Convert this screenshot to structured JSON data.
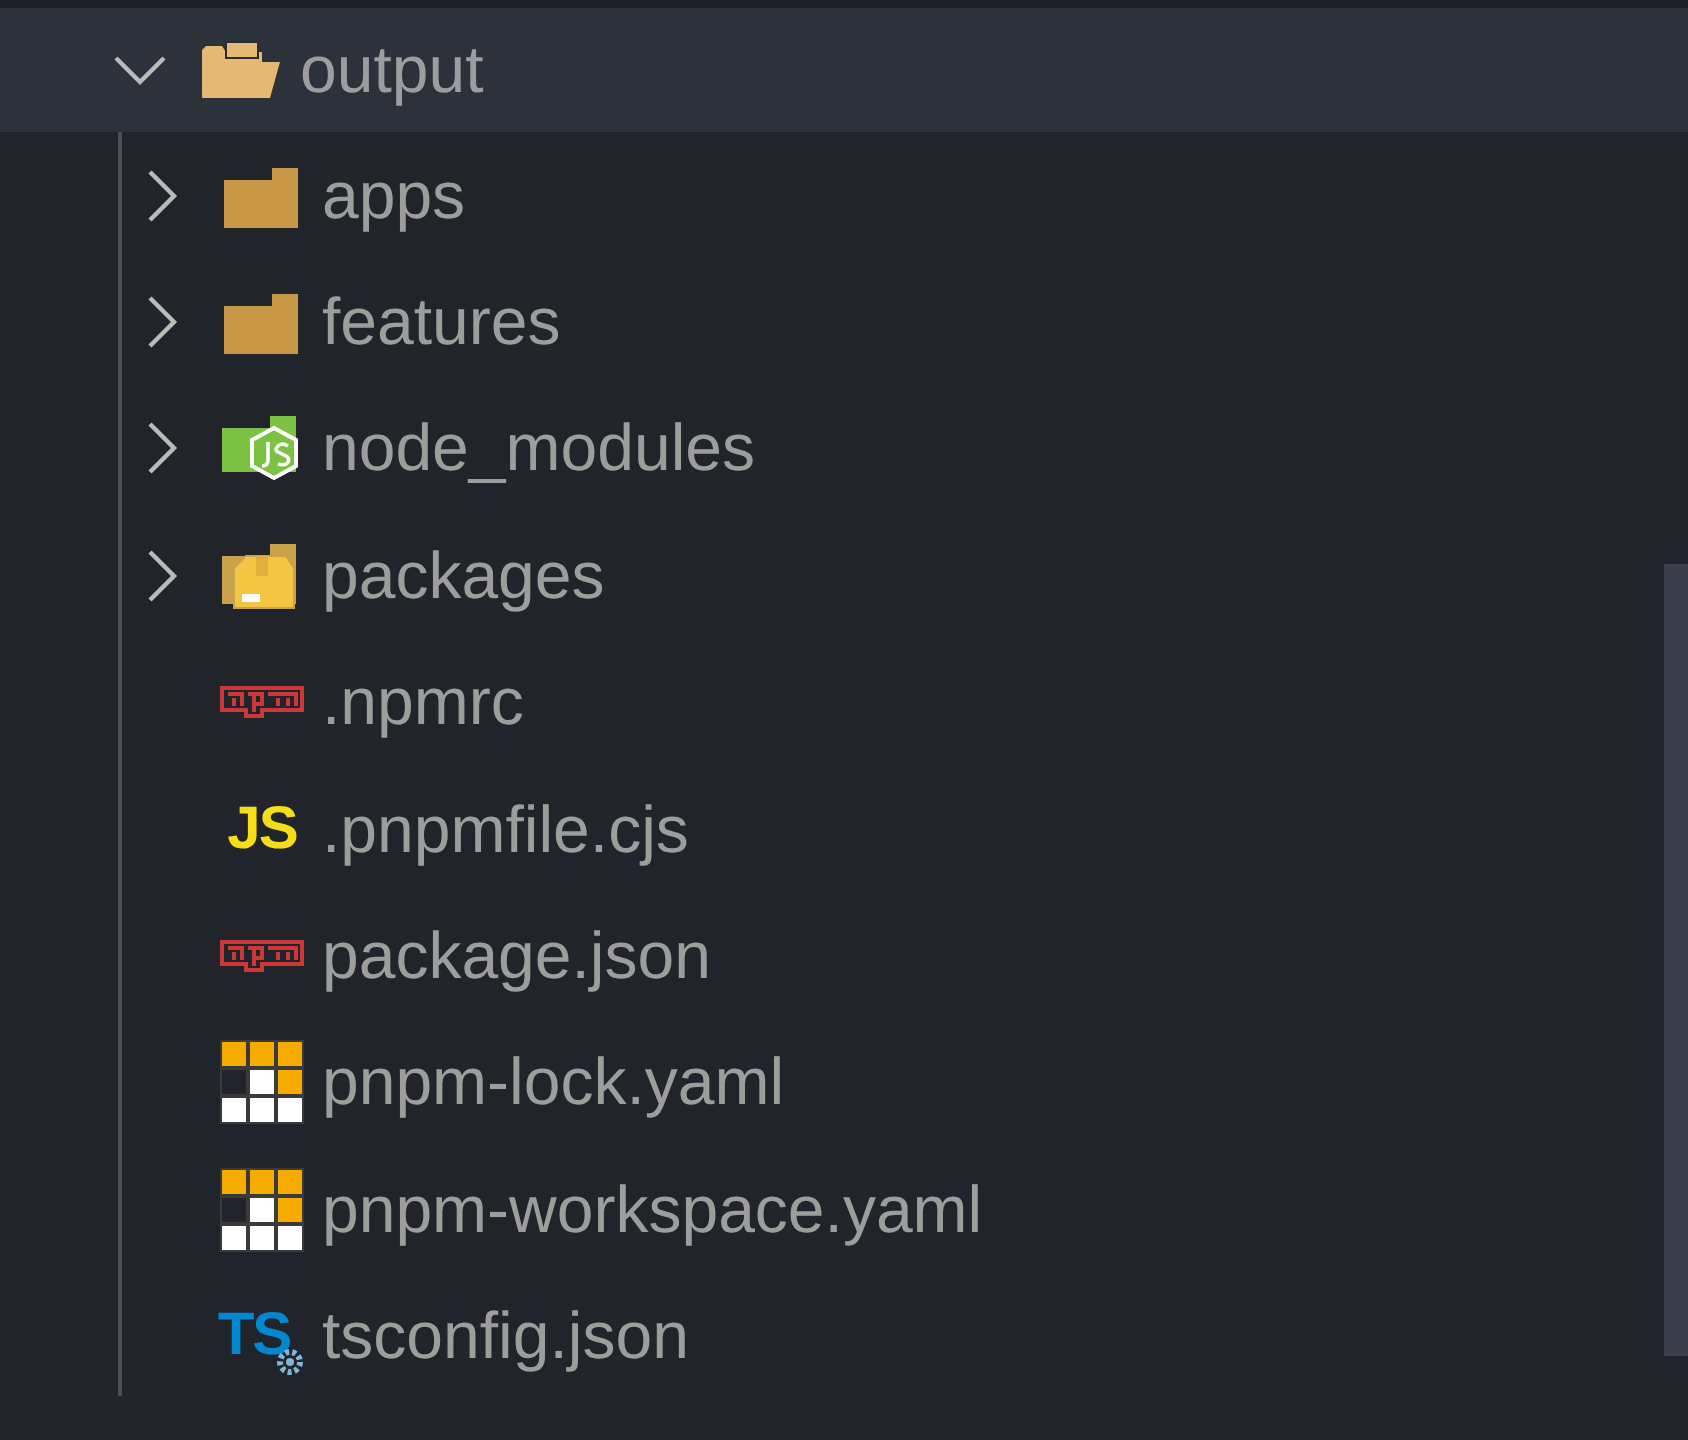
{
  "tree": {
    "name": "output",
    "expanded": true,
    "children": [
      {
        "name": "apps",
        "kind": "folder",
        "expanded": false
      },
      {
        "name": "features",
        "kind": "folder",
        "expanded": false
      },
      {
        "name": "node_modules",
        "kind": "modules",
        "expanded": false
      },
      {
        "name": "packages",
        "kind": "packages",
        "expanded": false
      },
      {
        "name": ".npmrc",
        "kind": "npm"
      },
      {
        "name": ".pnpmfile.cjs",
        "kind": "js",
        "icon_text": "JS"
      },
      {
        "name": "package.json",
        "kind": "npm"
      },
      {
        "name": "pnpm-lock.yaml",
        "kind": "pnpm"
      },
      {
        "name": "pnpm-workspace.yaml",
        "kind": "pnpm"
      },
      {
        "name": "tsconfig.json",
        "kind": "ts",
        "icon_text": "TS"
      }
    ]
  }
}
